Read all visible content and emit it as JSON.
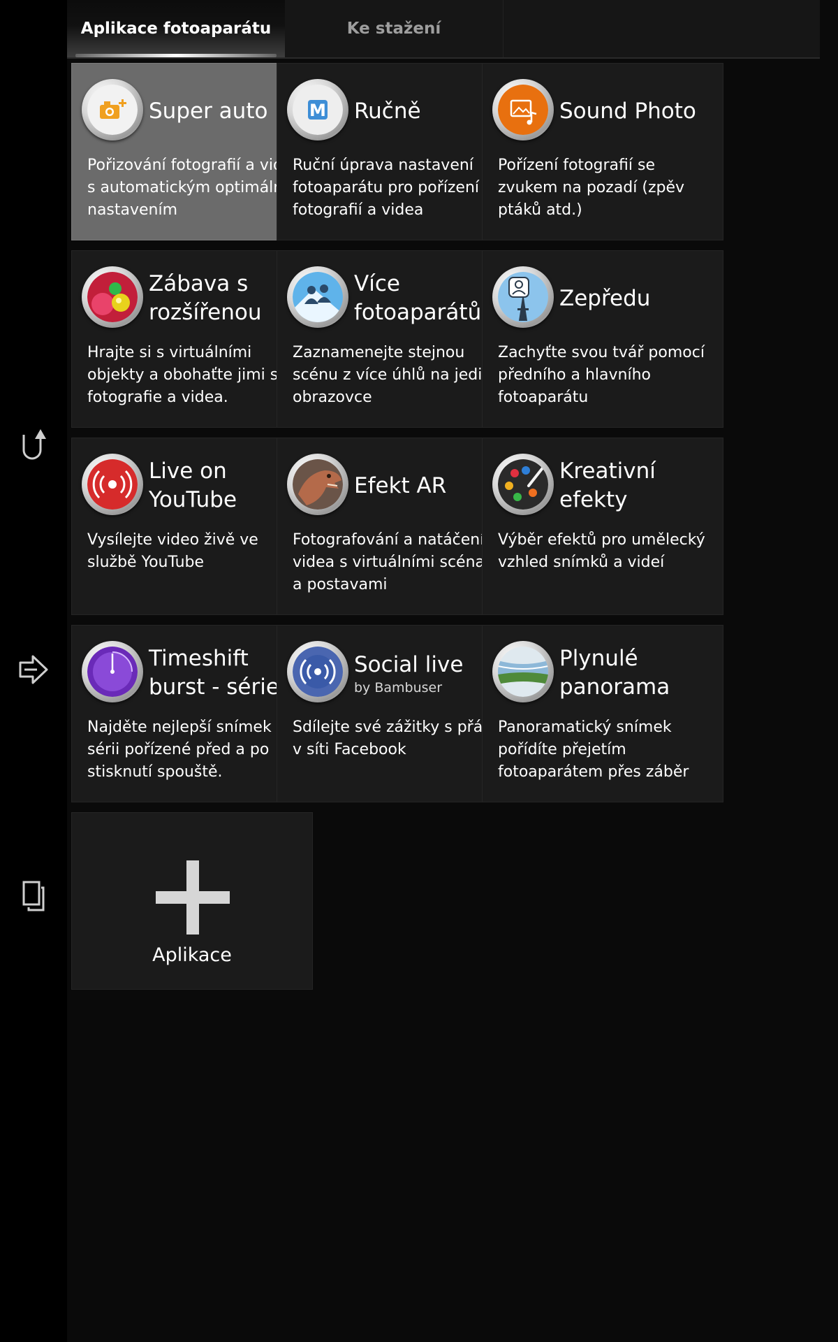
{
  "tabs": [
    {
      "label": "Aplikace fotoaparátu",
      "active": true
    },
    {
      "label": "Ke stažení",
      "active": false
    }
  ],
  "rail": [
    {
      "icon": "undo-icon"
    },
    {
      "icon": "share-arrow-icon"
    },
    {
      "icon": "copy-icon"
    }
  ],
  "apps": [
    {
      "title": "Super auto",
      "subtitle": "",
      "description": "Pořizování fotografií a videa s automatickým optimálním nastavením",
      "icon": "camera-plus-icon",
      "selected": true
    },
    {
      "title": "Ručně",
      "subtitle": "",
      "description": "Ruční úprava nastavení fotoaparátu pro pořízení fotografií a videa",
      "icon": "manual-m-icon",
      "selected": false
    },
    {
      "title": "Sound Photo",
      "subtitle": "",
      "description": "Pořízení fotografií se zvukem na pozadí (zpěv ptáků atd.)",
      "icon": "sound-photo-icon",
      "selected": false
    },
    {
      "title": "Zábava s rozšířenou",
      "subtitle": "",
      "description": "Hrajte si s virtuálními objekty a obohaťte jimi své fotografie a videa.",
      "icon": "ar-fun-icon",
      "selected": false
    },
    {
      "title": "Více fotoaparátů",
      "subtitle": "",
      "description": "Zaznamenejte stejnou scénu z více úhlů na jediné obrazovce",
      "icon": "multi-camera-icon",
      "selected": false
    },
    {
      "title": "Zepředu",
      "subtitle": "",
      "description": "Zachyťte svou tvář pomocí předního a hlavního fotoaparátu",
      "icon": "face-in-icon",
      "selected": false
    },
    {
      "title": "Live on YouTube",
      "subtitle": "",
      "description": "Vysílejte video živě ve službě YouTube",
      "icon": "live-broadcast-icon",
      "selected": false
    },
    {
      "title": "Efekt AR",
      "subtitle": "",
      "description": "Fotografování a natáčení videa s virtuálními scénami a postavami",
      "icon": "dinosaur-icon",
      "selected": false
    },
    {
      "title": "Kreativní efekty",
      "subtitle": "",
      "description": "Výběr efektů pro umělecký vzhled snímků a videí",
      "icon": "palette-icon",
      "selected": false
    },
    {
      "title": "Timeshift burst - série",
      "subtitle": "",
      "description": "Najděte nejlepší snímek v sérii pořízené před a po stisknutí spouště.",
      "icon": "clock-burst-icon",
      "selected": false
    },
    {
      "title": "Social live",
      "subtitle": "by Bambuser",
      "description": "Sdílejte své zážitky s přáteli v síti Facebook",
      "icon": "social-live-icon",
      "selected": false
    },
    {
      "title": "Plynulé panorama",
      "subtitle": "",
      "description": "Panoramatický snímek pořídíte přejetím fotoaparátem přes záběr",
      "icon": "panorama-icon",
      "selected": false
    }
  ],
  "add_tile": {
    "label": "Aplikace",
    "icon": "plus-icon"
  },
  "colors": {
    "background": "#000000",
    "panel": "#0a0a0a",
    "tile": "#1b1b1b",
    "tile_selected": "#6b6b6b",
    "text": "#ffffff",
    "tab_inactive_text": "#9e9e9e"
  }
}
